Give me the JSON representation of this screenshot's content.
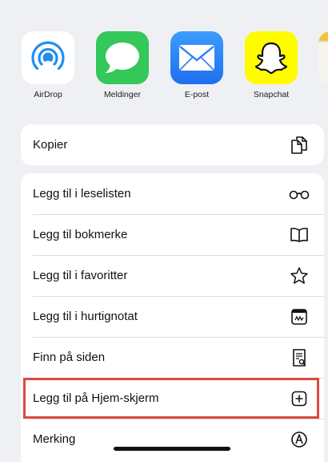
{
  "share_apps": [
    {
      "name": "AirDrop",
      "icon": "airdrop-icon"
    },
    {
      "name": "Meldinger",
      "icon": "messages-icon"
    },
    {
      "name": "E-post",
      "icon": "mail-icon"
    },
    {
      "name": "Snapchat",
      "icon": "snapchat-icon"
    }
  ],
  "actions_group1": [
    {
      "label": "Kopier",
      "icon": "copy-icon"
    }
  ],
  "actions_group2": [
    {
      "label": "Legg til i leselisten",
      "icon": "glasses-icon"
    },
    {
      "label": "Legg til bokmerke",
      "icon": "book-icon"
    },
    {
      "label": "Legg til i favoritter",
      "icon": "star-icon"
    },
    {
      "label": "Legg til i hurtignotat",
      "icon": "quick-note-icon"
    },
    {
      "label": "Finn på siden",
      "icon": "find-on-page-icon"
    },
    {
      "label": "Legg til på Hjem-skjerm",
      "icon": "add-square-icon",
      "highlighted": true
    },
    {
      "label": "Merking",
      "icon": "markup-icon"
    }
  ],
  "colors": {
    "background": "#eff0f4",
    "highlight_border": "#d94a3f",
    "airdrop_blue": "#1f8ef1",
    "messages_green": "#34c759",
    "mail_blue": "#2f7cf6",
    "snapchat_yellow": "#fffc00"
  }
}
